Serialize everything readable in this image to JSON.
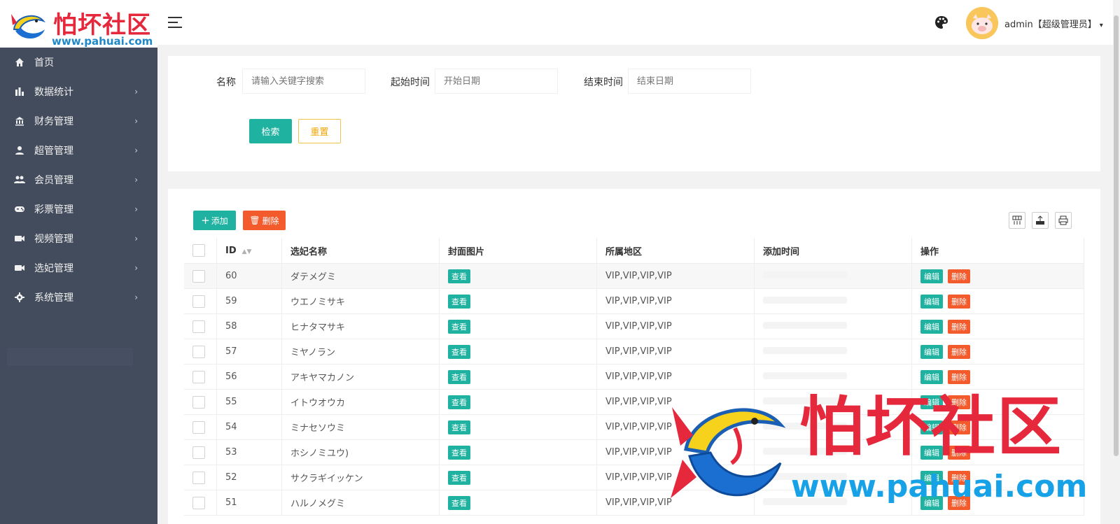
{
  "brand": {
    "logo_text": "怕坏社区",
    "logo_url": "www.pahuai.com"
  },
  "sidebar": {
    "items": [
      {
        "label": "首页",
        "icon": "home-icon",
        "has_arrow": false
      },
      {
        "label": "数据统计",
        "icon": "bar-chart-icon",
        "has_arrow": true
      },
      {
        "label": "财务管理",
        "icon": "bank-icon",
        "has_arrow": true
      },
      {
        "label": "超管管理",
        "icon": "person-icon",
        "has_arrow": true
      },
      {
        "label": "会员管理",
        "icon": "group-icon",
        "has_arrow": true
      },
      {
        "label": "彩票管理",
        "icon": "gamepad-icon",
        "has_arrow": true
      },
      {
        "label": "视频管理",
        "icon": "video-icon",
        "has_arrow": true
      },
      {
        "label": "选妃管理",
        "icon": "video-icon",
        "has_arrow": true
      },
      {
        "label": "系统管理",
        "icon": "gear-icon",
        "has_arrow": true
      }
    ],
    "arrow": "›"
  },
  "header": {
    "user_label": "admin【超级管理员】",
    "caret": "▾"
  },
  "search": {
    "name_label": "名称",
    "name_placeholder": "请输入关键字搜索",
    "start_label": "起始时间",
    "start_placeholder": "开始日期",
    "end_label": "结束时间",
    "end_placeholder": "结束日期",
    "search_button": "检索",
    "reset_button": "重置"
  },
  "toolbar": {
    "add_label": "添加",
    "delete_label": "删除"
  },
  "table": {
    "columns": [
      "ID",
      "选妃名称",
      "封面图片",
      "所属地区",
      "添加时间",
      "操作"
    ],
    "view_label": "查看",
    "edit_label": "编辑",
    "delete_label": "删除",
    "rows": [
      {
        "id": "60",
        "name": "ダテメグミ",
        "region": "VIP,VIP,VIP,VIP"
      },
      {
        "id": "59",
        "name": "ウエノミサキ",
        "region": "VIP,VIP,VIP,VIP"
      },
      {
        "id": "58",
        "name": "ヒナタマサキ",
        "region": "VIP,VIP,VIP,VIP"
      },
      {
        "id": "57",
        "name": "ミヤノラン",
        "region": "VIP,VIP,VIP,VIP"
      },
      {
        "id": "56",
        "name": "アキヤマカノン",
        "region": "VIP,VIP,VIP,VIP"
      },
      {
        "id": "55",
        "name": "イトウオウカ",
        "region": "VIP,VIP,VIP,VIP"
      },
      {
        "id": "54",
        "name": "ミナセソウミ",
        "region": "VIP,VIP,VIP,VIP"
      },
      {
        "id": "53",
        "name": "ホシノミユウ)",
        "region": "VIP,VIP,VIP,VIP"
      },
      {
        "id": "52",
        "name": "サクラギイッケン",
        "region": "VIP,VIP,VIP,VIP"
      },
      {
        "id": "51",
        "name": "ハルノメグミ",
        "region": "VIP,VIP,VIP,VIP"
      }
    ]
  },
  "watermark": {
    "text": "怕坏社区",
    "url": "www.pahuai.com"
  },
  "colors": {
    "primary": "#20b2a0",
    "danger": "#f35a2c",
    "warning": "#f0a500",
    "sidebar_bg": "#434c5c",
    "brand_red": "#e5283c",
    "brand_blue": "#17a2e8"
  }
}
